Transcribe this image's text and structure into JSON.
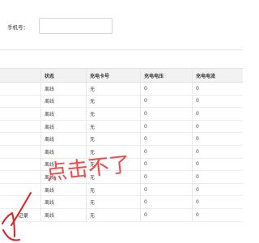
{
  "filter": {
    "phone_label": "手机号：",
    "phone_value": "",
    "phone_placeholder": ""
  },
  "table": {
    "columns": [
      "",
      "状态",
      "充电卡号",
      "充电电压",
      "充电电流"
    ],
    "rows": [
      [
        "",
        "离线",
        "无",
        "0",
        "0"
      ],
      [
        "",
        "离线",
        "无",
        "0",
        "0"
      ],
      [
        "",
        "离线",
        "无",
        "0",
        "0"
      ],
      [
        "",
        "离线",
        "无",
        "0",
        "0"
      ],
      [
        "",
        "离线",
        "无",
        "0",
        "0"
      ],
      [
        "",
        "离线",
        "无",
        "0",
        "0"
      ],
      [
        "",
        "离线",
        "无",
        "0",
        "0"
      ],
      [
        "",
        "离线",
        "无",
        "0",
        "0"
      ],
      [
        "",
        "离线",
        "无",
        "0",
        "0"
      ],
      [
        "",
        "离线",
        "无",
        "0",
        "0"
      ],
      [
        "",
        "离线",
        "无",
        "0",
        "0"
      ]
    ]
  },
  "pager": {
    "record_text": "记录"
  },
  "annotation": {
    "text": "点击不了",
    "color": "#f04a4a",
    "arrow_color": "#e02020"
  }
}
